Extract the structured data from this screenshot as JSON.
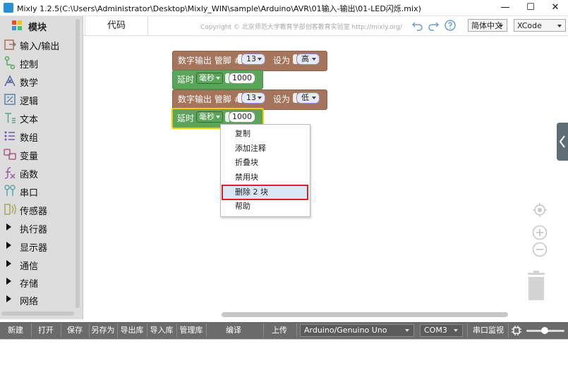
{
  "window": {
    "title": "Mixly 1.2.5(C:\\Users\\Administrator\\Desktop\\Mixly_WIN\\sample\\Arduino\\AVR\\01输入-输出\\01-LED闪烁.mix)",
    "minimize": "—",
    "maximize": "☐",
    "close": "✕"
  },
  "sidebar": {
    "header": "模块",
    "items": [
      {
        "label": "输入/输出",
        "icon": "io-icon"
      },
      {
        "label": "控制",
        "icon": "control-icon"
      },
      {
        "label": "数学",
        "icon": "math-icon"
      },
      {
        "label": "逻辑",
        "icon": "logic-icon"
      },
      {
        "label": "文本",
        "icon": "text-icon"
      },
      {
        "label": "数组",
        "icon": "array-icon"
      },
      {
        "label": "变量",
        "icon": "variable-icon"
      },
      {
        "label": "函数",
        "icon": "function-icon"
      },
      {
        "label": "串口",
        "icon": "serial-icon"
      },
      {
        "label": "传感器",
        "icon": "sensor-icon"
      },
      {
        "label": "执行器",
        "icon": "expand-arrow-icon"
      },
      {
        "label": "显示器",
        "icon": "expand-arrow-icon"
      },
      {
        "label": "通信",
        "icon": "expand-arrow-icon"
      },
      {
        "label": "存储",
        "icon": "expand-arrow-icon"
      },
      {
        "label": "网络",
        "icon": "expand-arrow-icon"
      }
    ]
  },
  "tabbar": {
    "code_tab": "代码",
    "copyright": "Copyright © 北京师范大学教育学部创客教育实验室 http://mixly.org/",
    "language": "简体中文",
    "theme": "XCode"
  },
  "blocks": [
    {
      "type": "digital_write",
      "label": "数字输出 管脚 #",
      "pin": "13",
      "set_label": "设为",
      "value": "高"
    },
    {
      "type": "delay",
      "label": "延时",
      "unit": "毫秒",
      "value": "1000"
    },
    {
      "type": "digital_write",
      "label": "数字输出 管脚 #",
      "pin": "13",
      "set_label": "设为",
      "value": "低"
    },
    {
      "type": "delay",
      "label": "延时",
      "unit": "毫秒",
      "value": "1000",
      "selected": true
    }
  ],
  "context_menu": {
    "items": [
      "复制",
      "添加注释",
      "折叠块",
      "禁用块",
      "删除 2 块",
      "帮助"
    ],
    "highlighted_index": 4
  },
  "bottom_toolbar": {
    "buttons": [
      "新建",
      "打开",
      "保存",
      "另存为",
      "导出库",
      "导入库",
      "管理库",
      "编译",
      "上传"
    ],
    "board": "Arduino/Genuino Uno",
    "port": "COM3",
    "serial_monitor": "串口监视器"
  },
  "colors": {
    "output_block": "#a5745b",
    "delay_block": "#5ba55b",
    "selected_outline": "#f5d000",
    "menu_highlight_border": "#e02020",
    "bottom_bar": "#6b6b6b"
  }
}
